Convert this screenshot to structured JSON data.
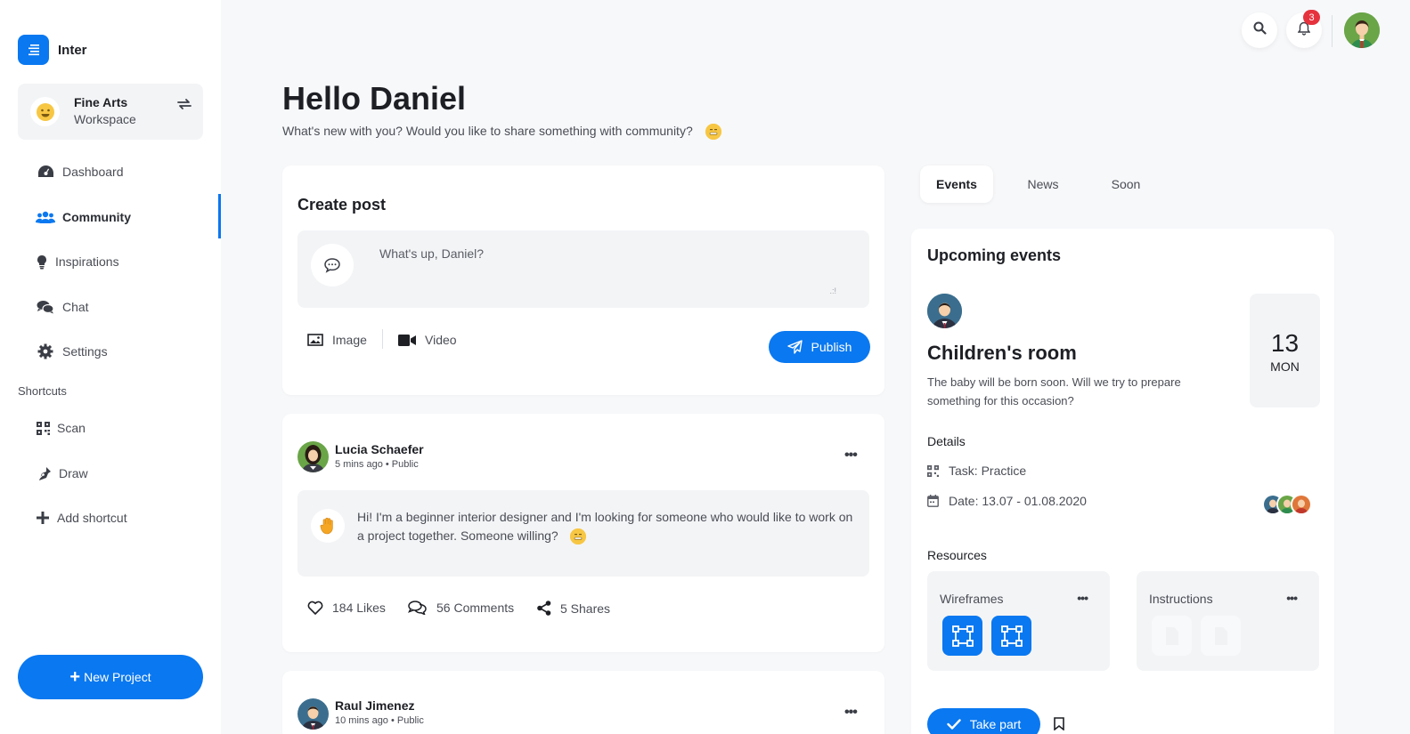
{
  "brand": {
    "name": "Inter"
  },
  "workspace": {
    "title": "Fine Arts",
    "subtitle": "Workspace"
  },
  "nav": [
    {
      "label": "Dashboard",
      "icon": "dashboard-icon"
    },
    {
      "label": "Community",
      "icon": "users-icon",
      "active": true
    },
    {
      "label": "Inspirations",
      "icon": "lightbulb-icon"
    },
    {
      "label": "Chat",
      "icon": "chat-icon"
    },
    {
      "label": "Settings",
      "icon": "gear-icon"
    }
  ],
  "shortcuts": {
    "label": "Shortcuts",
    "items": [
      {
        "label": "Scan",
        "icon": "qr-icon"
      },
      {
        "label": "Draw",
        "icon": "pen-icon"
      },
      {
        "label": "Add shortcut",
        "icon": "plus-icon"
      }
    ]
  },
  "new_project": "New Project",
  "topbar": {
    "notifications_count": "3"
  },
  "header": {
    "title": "Hello Daniel",
    "subtitle": "What's new with you? Would you like to share something with community?"
  },
  "create_post": {
    "title": "Create post",
    "placeholder": "What's up, Daniel?",
    "image_label": "Image",
    "video_label": "Video",
    "publish_label": "Publish"
  },
  "posts": [
    {
      "author": "Lucia Schaefer",
      "meta": "5 mins ago • Public",
      "text": "Hi! I'm a beginner interior designer and I'm looking for someone who would like to work on a project together. Someone willing?",
      "likes": "184 Likes",
      "comments": "56 Comments",
      "shares": "5 Shares"
    },
    {
      "author": "Raul Jimenez",
      "meta": "10 mins ago • Public"
    }
  ],
  "tabs": [
    {
      "label": "Events",
      "active": true
    },
    {
      "label": "News"
    },
    {
      "label": "Soon"
    }
  ],
  "events": {
    "title": "Upcoming events",
    "name": "Children's room",
    "description": "The baby will be born soon. Will we try to prepare something for this occasion?",
    "date_num": "13",
    "date_day": "MON",
    "details_label": "Details",
    "task": "Task: Practice",
    "date_range": "Date: 13.07 - 01.08.2020",
    "resources_label": "Resources",
    "resources": [
      {
        "title": "Wireframes"
      },
      {
        "title": "Instructions"
      }
    ],
    "take_part": "Take part"
  },
  "colors": {
    "accent": "#0a78f0",
    "badge": "#e6323d",
    "surface": "#f3f4f6"
  }
}
